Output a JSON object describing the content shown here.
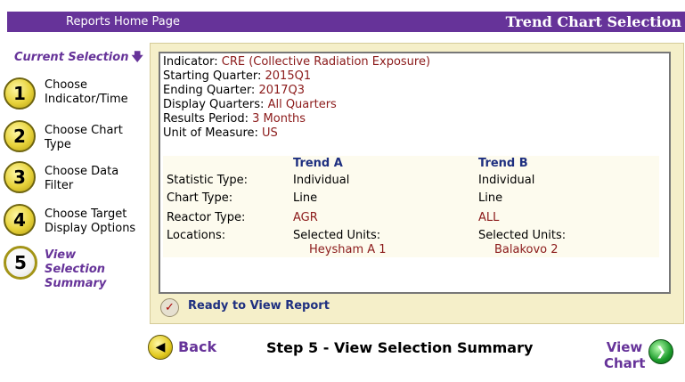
{
  "header": {
    "home_link": "Reports Home Page",
    "title": "Trend Chart Selection"
  },
  "sidebar": {
    "current_selection": "Current Selection",
    "steps": [
      {
        "number": "1",
        "label": "Choose Indicator/Time"
      },
      {
        "number": "2",
        "label": "Choose Chart Type"
      },
      {
        "number": "3",
        "label": "Choose Data Filter"
      },
      {
        "number": "4",
        "label": "Choose Target Display Options"
      },
      {
        "number": "5",
        "label": "View Selection Summary"
      }
    ]
  },
  "summary": {
    "indicator_label": "Indicator:",
    "indicator_value": "CRE (Collective Radiation Exposure)",
    "starting_label": "Starting Quarter:",
    "starting_value": "2015Q1",
    "ending_label": "Ending Quarter:",
    "ending_value": "2017Q3",
    "display_label": "Display Quarters:",
    "display_value": "All Quarters",
    "results_label": "Results Period:",
    "results_value": "3 Months",
    "unit_label": "Unit of Measure:",
    "unit_value": "US"
  },
  "trends": {
    "col_a": "Trend A",
    "col_b": "Trend B",
    "rows": [
      {
        "label": "Statistic Type:",
        "a": "Individual",
        "b": "Individual"
      },
      {
        "label": "Chart Type:",
        "a": "Line",
        "b": "Line"
      },
      {
        "label": "Reactor Type:",
        "a": "AGR",
        "b": "ALL"
      },
      {
        "label": "Locations:",
        "a": "Selected Units:",
        "b": "Selected Units:"
      }
    ],
    "units_a": "Heysham A 1",
    "units_b": "Balakovo 2"
  },
  "status": {
    "ready": "Ready to View Report"
  },
  "footer": {
    "back": "Back",
    "step_title": "Step 5 - View Selection Summary",
    "view_chart": "View Chart"
  },
  "colors": {
    "brand": "#663399",
    "value_text": "#8b1a1a",
    "heading_text": "#1e2f80"
  }
}
